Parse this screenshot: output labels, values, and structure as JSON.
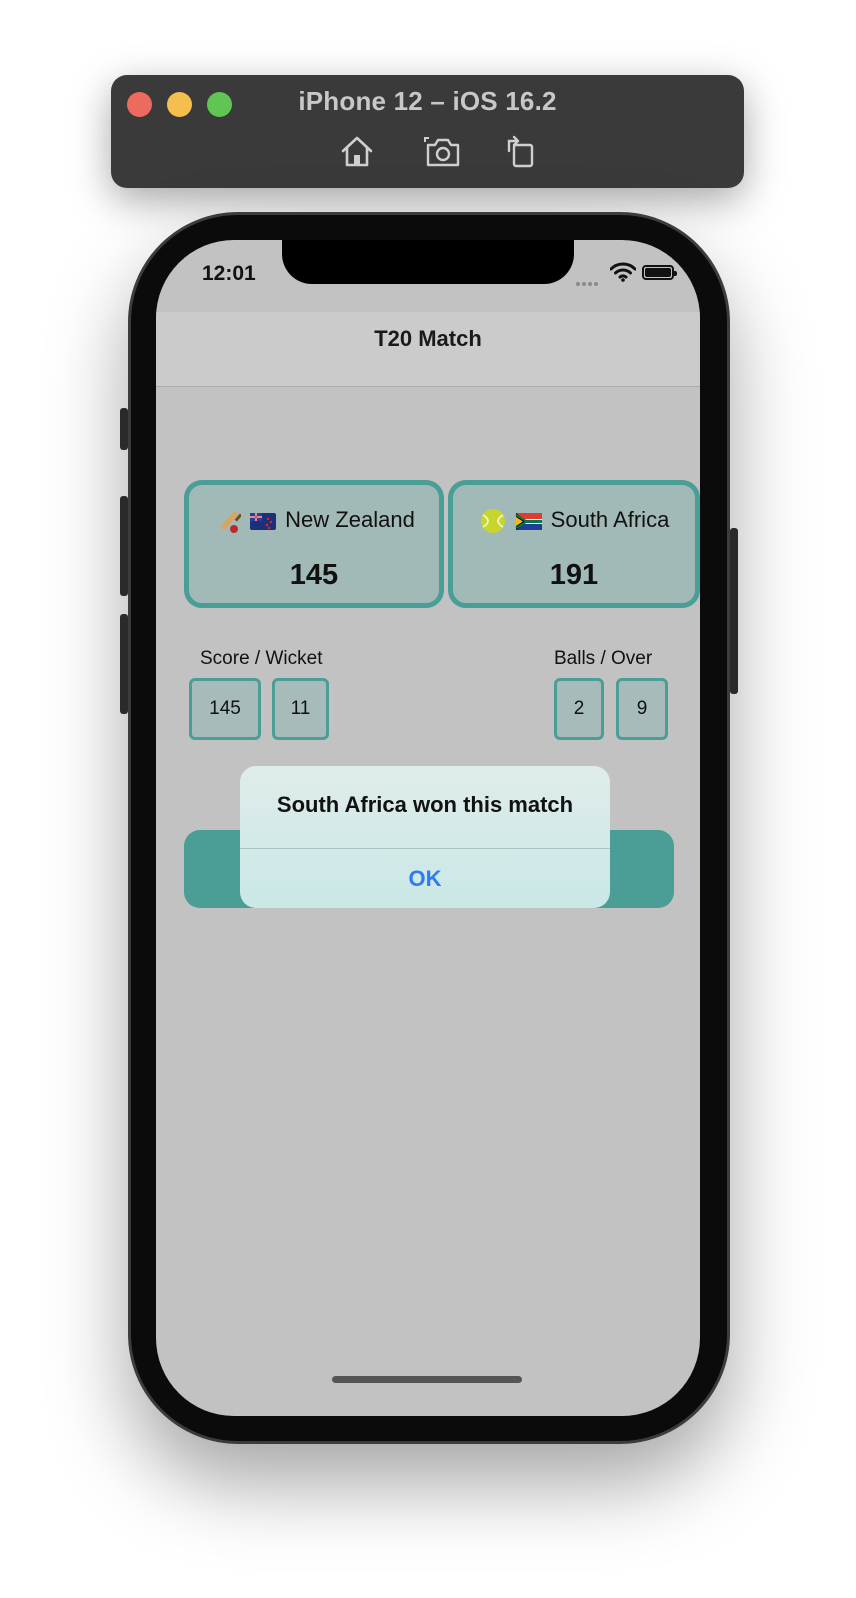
{
  "simulator": {
    "title": "iPhone 12 – iOS 16.2",
    "buttons": [
      "home-icon",
      "screenshot-icon",
      "rotate-icon"
    ]
  },
  "status_bar": {
    "time": "12:01"
  },
  "nav": {
    "title": "T20 Match"
  },
  "teams": [
    {
      "emoji": "cricket-bat-icon",
      "flag": "new-zealand-flag-icon",
      "name": "New Zealand",
      "score": "145"
    },
    {
      "emoji": "ball-icon",
      "flag": "south-africa-flag-icon",
      "name": "South Africa",
      "score": "191"
    }
  ],
  "score_wicket": {
    "label": "Score / Wicket",
    "score": "145",
    "wicket": "11"
  },
  "balls_over": {
    "label": "Balls / Over",
    "balls": "2",
    "over": "9"
  },
  "alert": {
    "message": "South Africa won this match",
    "ok_label": "OK"
  },
  "colors": {
    "accent": "#4a9e96",
    "card_bg": "#a1b9b7",
    "screen_bg": "#c2c2c2",
    "link_blue": "#2f7bf5"
  }
}
